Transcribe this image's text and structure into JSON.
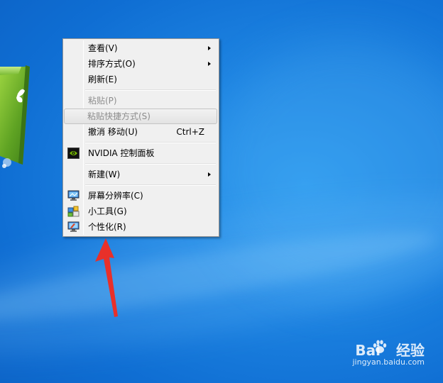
{
  "context_menu": {
    "items": [
      {
        "label": "查看(V)",
        "submenu": true
      },
      {
        "label": "排序方式(O)",
        "submenu": true
      },
      {
        "label": "刷新(E)"
      },
      {
        "label": "粘贴(P)",
        "disabled": true
      },
      {
        "label": "粘贴快捷方式(S)",
        "disabled": true,
        "highlighted": true
      },
      {
        "label": "撤消 移动(U)",
        "shortcut": "Ctrl+Z"
      },
      {
        "label": "NVIDIA 控制面板",
        "icon": "nvidia-icon"
      },
      {
        "label": "新建(W)",
        "submenu": true
      },
      {
        "label": "屏幕分辨率(C)",
        "icon": "display-resolution-icon"
      },
      {
        "label": "小工具(G)",
        "icon": "gadgets-icon"
      },
      {
        "label": "个性化(R)",
        "icon": "personalize-icon"
      }
    ]
  },
  "watermark": {
    "brand_prefix": "Bai",
    "brand_suffix": "经验",
    "url": "jingyan.baidu.com"
  },
  "colors": {
    "desktop_blue": "#1f86e3",
    "menu_background": "#f0f0f0",
    "arrow_red": "#e8302a",
    "tile_green": "#6fb02a"
  }
}
